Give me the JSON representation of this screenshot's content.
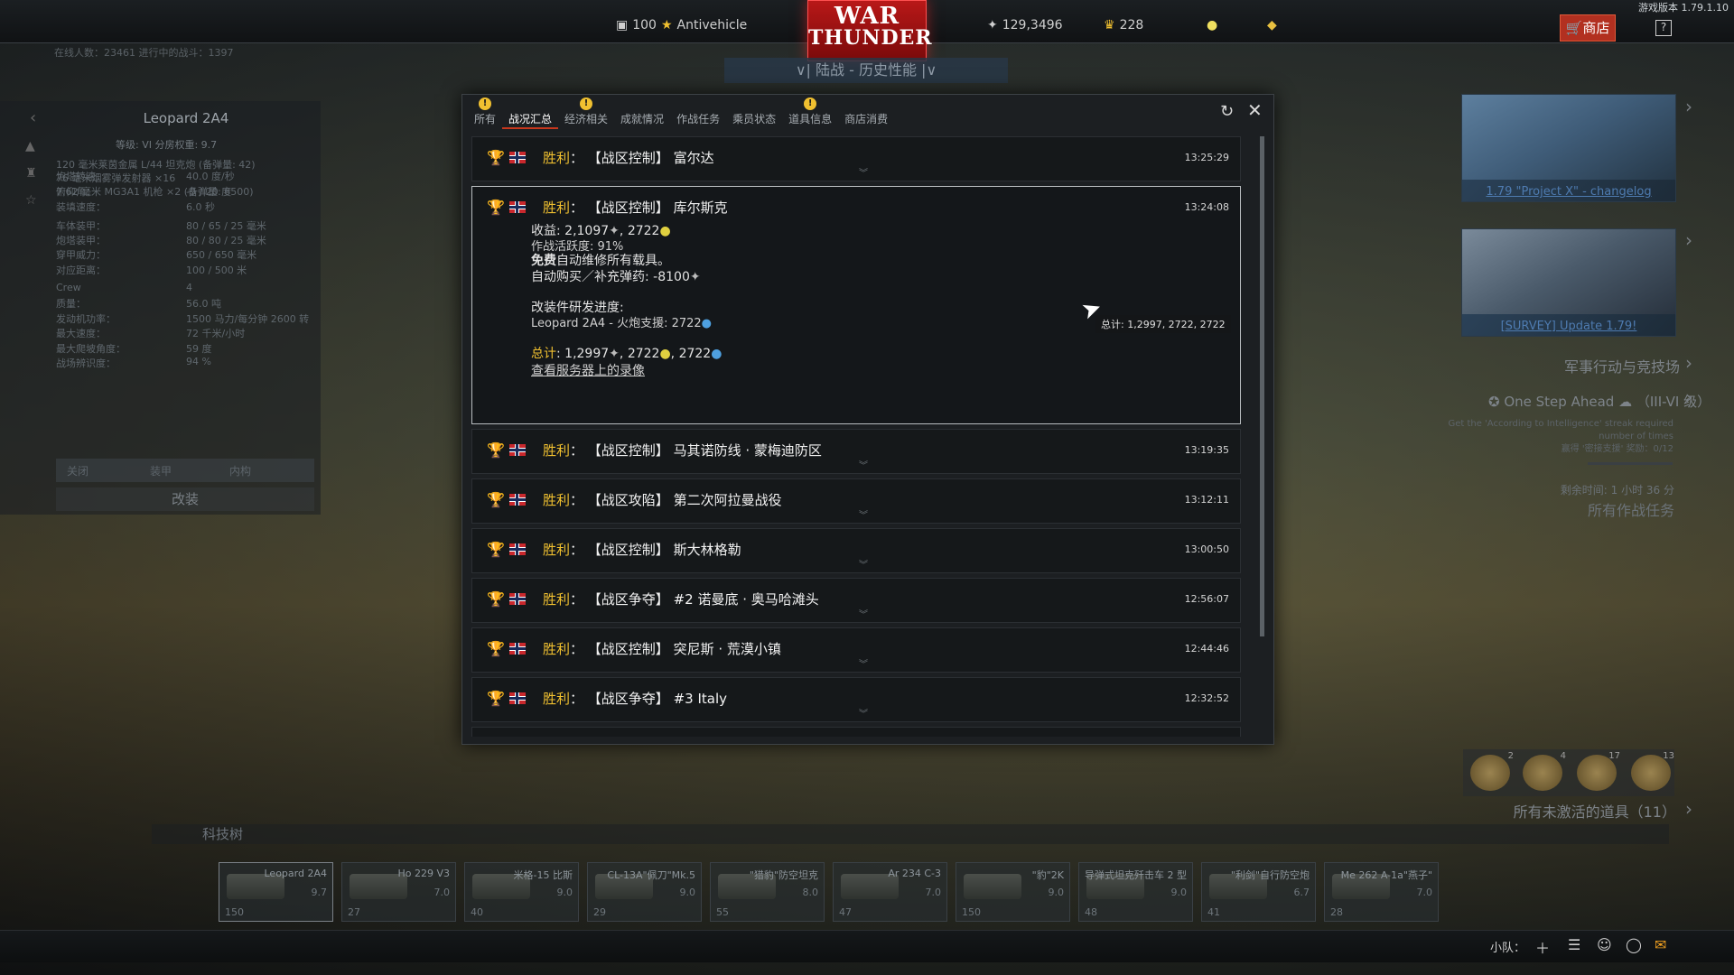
{
  "version": "游戏版本 1.79.1.10",
  "top": {
    "premium_count": "100",
    "premium_label": "Antivehicle",
    "silver_lions": "129,3496",
    "golden_eagles": "228",
    "logo_line1": "WAR",
    "logo_line2": "THUNDER",
    "mode": "陆战 - 历史性能",
    "shop": "商店",
    "help": "?"
  },
  "online": "在线人数：23461   进行中的战斗：1397",
  "vehicle_panel": {
    "name": "Leopard 2A4",
    "rank": "等级: VI   分房权重: 9.7",
    "armament": [
      "120 毫米莱茵金属 L/44 坦克炮 (备弹量: 42)",
      "76 毫米烟雾弹发射器 ×16",
      "7.62 毫米 MG3A1 机枪 ×2 (备弹量: 6500)"
    ],
    "stats": [
      {
        "k": "炮塔转速：",
        "v": "40.0 度/秒"
      },
      {
        "k": "俯仰角：",
        "v": "-9 / 20 度"
      },
      {
        "k": "装填速度：",
        "v": "6.0 秒"
      },
      {
        "k": "车体装甲：",
        "v": "80 / 65 / 25 毫米"
      },
      {
        "k": "炮塔装甲：",
        "v": "80 / 80 / 25 毫米"
      },
      {
        "k": "穿甲威力：",
        "v": "650 / 650 毫米"
      },
      {
        "k": "对应距离：",
        "v": "100 / 500 米"
      },
      {
        "k": "Crew",
        "v": "4"
      },
      {
        "k": "质量：",
        "v": "56.0 吨"
      },
      {
        "k": "发动机功率：",
        "v": "1500 马力/每分钟 2600 转"
      },
      {
        "k": "最大速度：",
        "v": "72 千米/小时"
      },
      {
        "k": "最大爬坡角度：",
        "v": "59 度"
      },
      {
        "k": "战场辨识度：",
        "v": "94 %"
      }
    ],
    "tabs": [
      "关闭",
      "装甲",
      "内构"
    ],
    "modify": "改装"
  },
  "right": {
    "news1": "1.79 \"Project X\" - changelog",
    "news2": "[SURVEY] Update 1.79!",
    "war_activities": "军事行动与竞技场",
    "task_title": "One Step Ahead",
    "task_rank": "（III-VI 级）",
    "task_desc": "Get the 'According to Intelligence' streak required number of times",
    "task_reward": "赢得 '密接支援' 奖励：0/12",
    "task_time": "剩余时间: 1 小时 36 分",
    "all_tasks": "所有作战任务",
    "boosters": [
      "2",
      "4",
      "17",
      "13"
    ],
    "inactive": "所有未激活的道具（11）"
  },
  "techtree": {
    "label": "科技树",
    "slots": [
      {
        "name": "Leopard 2A4",
        "br": "9.7",
        "crew": "150"
      },
      {
        "name": "Ho 229 V3",
        "br": "7.0",
        "crew": "27"
      },
      {
        "name": "米格-15 比斯",
        "br": "9.0",
        "crew": "40"
      },
      {
        "name": "CL-13A\"佩刀\"Mk.5",
        "br": "9.0",
        "crew": "29"
      },
      {
        "name": "\"猎豹\"防空坦克",
        "br": "8.0",
        "crew": "55"
      },
      {
        "name": "Ar 234 C-3",
        "br": "7.0",
        "crew": "47"
      },
      {
        "name": "\"豹\"2K",
        "br": "9.0",
        "crew": "150"
      },
      {
        "name": "导弹式坦克歼击车 2 型",
        "br": "9.0",
        "crew": "48"
      },
      {
        "name": "\"利剑\"自行防空炮",
        "br": "6.7",
        "crew": "41"
      },
      {
        "name": "Me 262 A-1a\"燕子\"",
        "br": "7.0",
        "crew": "28"
      }
    ]
  },
  "bottom": {
    "squad": "小队："
  },
  "dialog": {
    "tabs": [
      {
        "label": "所有",
        "warn": true
      },
      {
        "label": "战况汇总",
        "warn": false,
        "active": true
      },
      {
        "label": "经济相关",
        "warn": true
      },
      {
        "label": "成就情况",
        "warn": false
      },
      {
        "label": "作战任务",
        "warn": false
      },
      {
        "label": "乘员状态",
        "warn": false
      },
      {
        "label": "道具信息",
        "warn": true
      },
      {
        "label": "商店消费",
        "warn": false
      }
    ],
    "win_label": "胜利",
    "entries": [
      {
        "title": "【战区控制】 富尔达",
        "time": "13:25:29"
      },
      {
        "title": "【战区控制】 库尔斯克",
        "time": "13:24:08",
        "expanded": true
      },
      {
        "title": "【战区控制】 马其诺防线 · 蒙梅迪防区",
        "time": "13:19:35"
      },
      {
        "title": "【战区攻陷】 第二次阿拉曼战役",
        "time": "13:12:11"
      },
      {
        "title": "【战区控制】 斯大林格勒",
        "time": "13:00:50"
      },
      {
        "title": "【战区争夺】 #2 诺曼底 · 奥马哈滩头",
        "time": "12:56:07"
      },
      {
        "title": "【战区控制】 突尼斯 · 荒漠小镇",
        "time": "12:44:46"
      },
      {
        "title": "【战区争夺】 #3 Italy",
        "time": "12:32:52"
      }
    ],
    "detail": {
      "income_label": "收益",
      "income_silver": "2,1097",
      "income_rp": "2722",
      "activity": "作战活跃度: 91%",
      "free_bold": "免费",
      "free_rest": "自动维修所有载具。",
      "autobuy": "自动购买／补充弹药: -8100",
      "mod_title": "改装件研发进度",
      "mod_line": "Leopard 2A4 - 火炮支援: 2722",
      "total_label": "总计",
      "total_silver": "1,2997",
      "total_rp": "2722",
      "total_crp": "2722",
      "replay_link": "查看服务器上的录像",
      "tooltip": "总计: 1,2997, 2722, 2722"
    }
  }
}
